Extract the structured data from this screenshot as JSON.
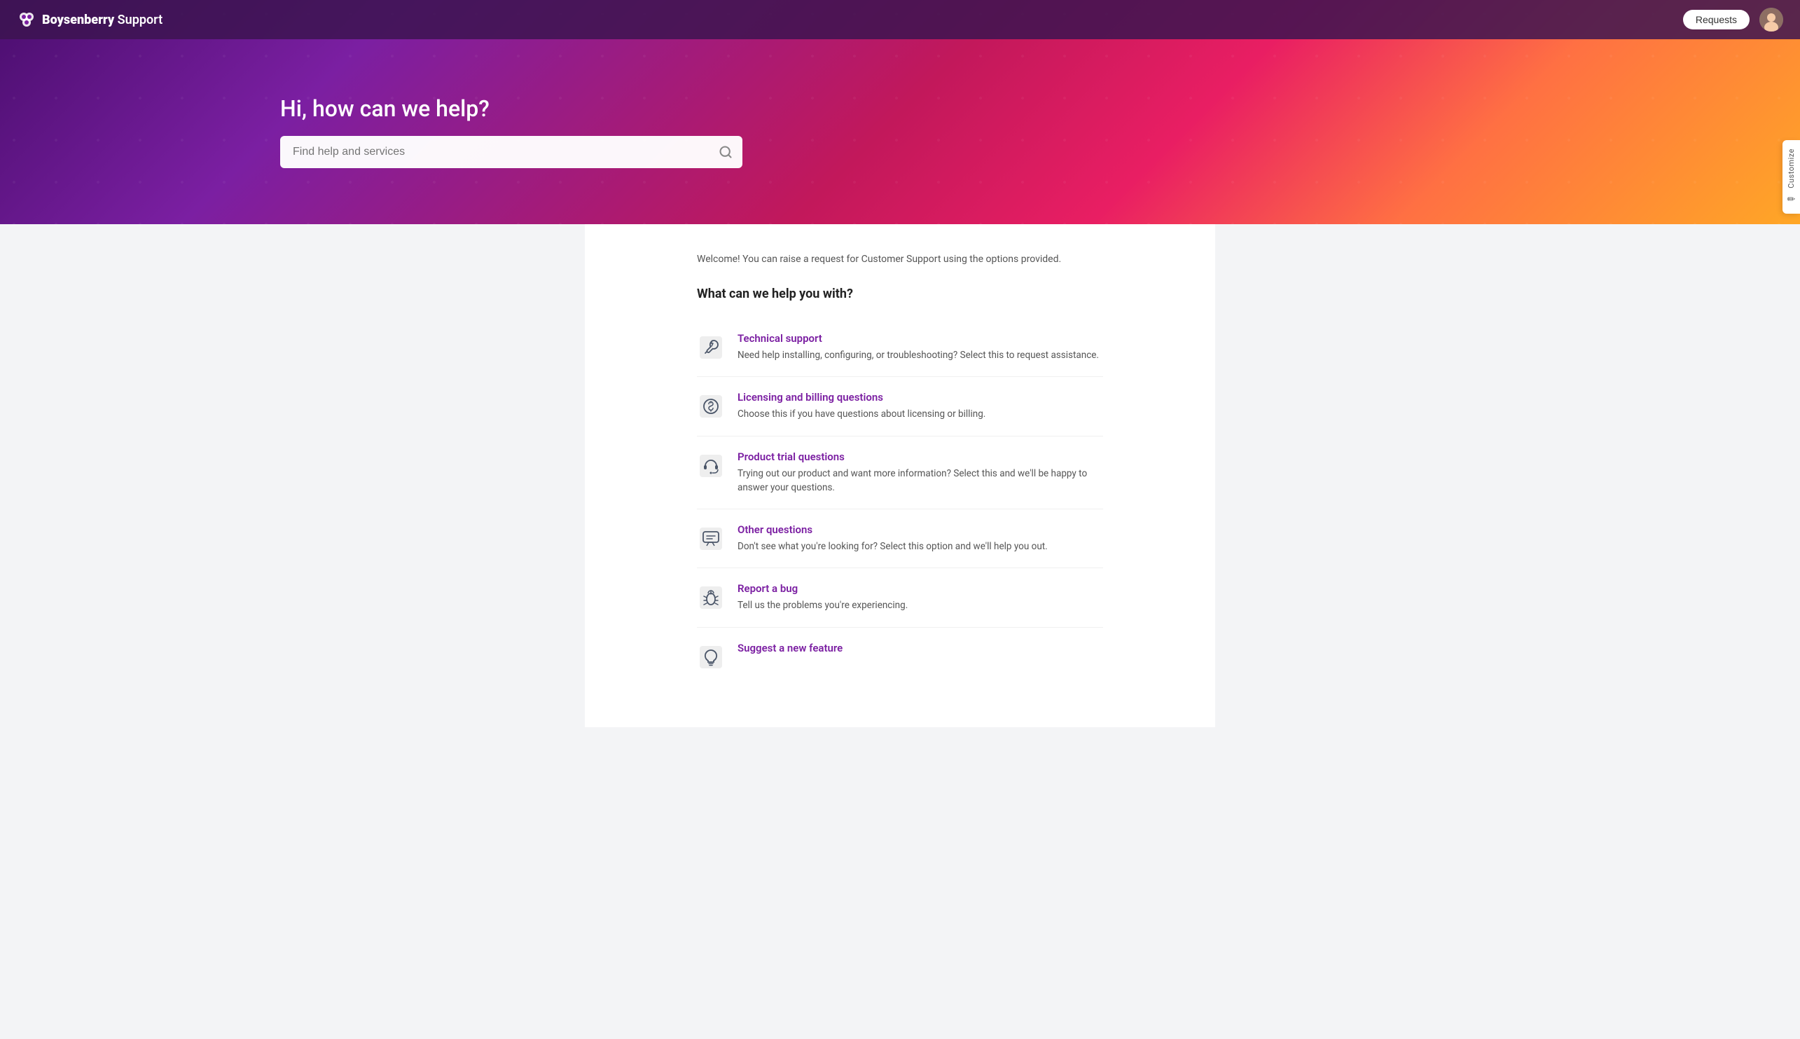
{
  "header": {
    "logo_name": "Boysenberry",
    "logo_suffix": " Support",
    "requests_label": "Requests"
  },
  "hero": {
    "title": "Hi, how can we help?",
    "search_placeholder": "Find help and services"
  },
  "customize": {
    "label": "Customize",
    "pencil": "✏"
  },
  "main": {
    "welcome_text": "Welcome! You can raise a request for Customer Support using the options provided.",
    "section_title": "What can we help you with?",
    "categories": [
      {
        "id": "technical-support",
        "title": "Technical support",
        "description": "Need help installing, configuring, or troubleshooting? Select this to request assistance.",
        "icon": "tools"
      },
      {
        "id": "licensing-billing",
        "title": "Licensing and billing questions",
        "description": "Choose this if you have questions about licensing or billing.",
        "icon": "dollar"
      },
      {
        "id": "product-trial",
        "title": "Product trial questions",
        "description": "Trying out our product and want more information? Select this and we'll be happy to answer your questions.",
        "icon": "headset"
      },
      {
        "id": "other-questions",
        "title": "Other questions",
        "description": "Don't see what you're looking for? Select this option and we'll help you out.",
        "icon": "chat"
      },
      {
        "id": "report-bug",
        "title": "Report a bug",
        "description": "Tell us the problems you're experiencing.",
        "icon": "bug"
      },
      {
        "id": "suggest-feature",
        "title": "Suggest a new feature",
        "description": "",
        "icon": "lightbulb"
      }
    ]
  }
}
